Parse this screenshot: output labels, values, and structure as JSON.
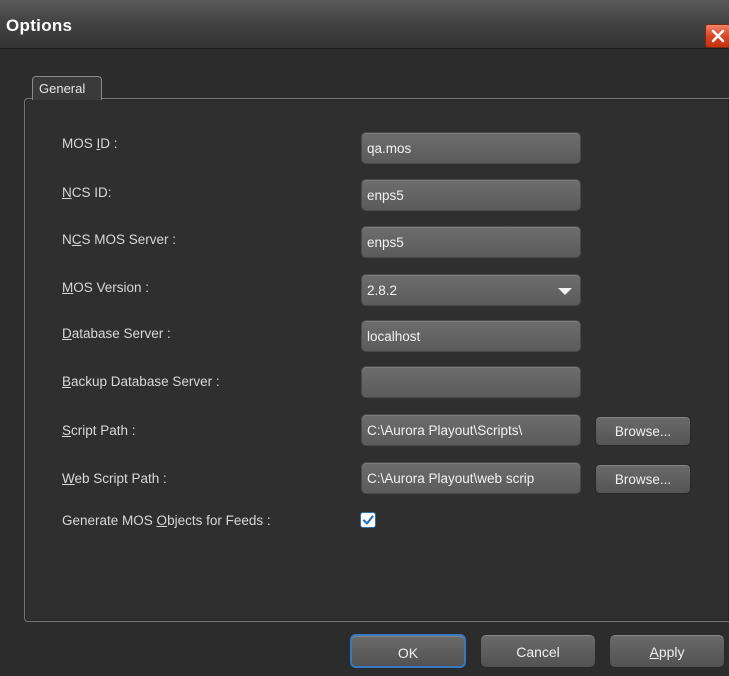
{
  "window": {
    "title": "Options"
  },
  "tabs": [
    {
      "label": "General"
    }
  ],
  "form": {
    "mos_id": {
      "label_pre": "MOS ",
      "label_key": "I",
      "label_post": "D :",
      "value": "qa.mos"
    },
    "ncs_id": {
      "label_pre": "",
      "label_key": "N",
      "label_post": "CS ID:",
      "value": "enps5"
    },
    "ncs_mos_server": {
      "label_pre": "N",
      "label_key": "C",
      "label_post": "S MOS Server :",
      "value": "enps5"
    },
    "mos_version": {
      "label_pre": "",
      "label_key": "M",
      "label_post": "OS Version :",
      "value": "2.8.2"
    },
    "database_server": {
      "label_pre": "",
      "label_key": "D",
      "label_post": "atabase Server :",
      "value": "localhost"
    },
    "backup_database_server": {
      "label_pre": "",
      "label_key": "B",
      "label_post": "ackup Database Server :",
      "value": ""
    },
    "script_path": {
      "label_pre": "",
      "label_key": "S",
      "label_post": "cript Path :",
      "value": "C:\\Aurora Playout\\Scripts\\"
    },
    "web_script_path": {
      "label_pre": "",
      "label_key": "W",
      "label_post": "eb Script Path :",
      "value": "C:\\Aurora Playout\\web scrip"
    },
    "generate_mos_objects": {
      "label_pre": "Generate MOS ",
      "label_key": "O",
      "label_post": "bjects for Feeds :",
      "checked": true
    }
  },
  "buttons": {
    "browse": "Browse...",
    "ok": "OK",
    "cancel": "Cancel",
    "apply_key": "A",
    "apply_rest": "pply"
  },
  "icons": {
    "close": "close-icon",
    "dropdown": "chevron-down-icon",
    "check": "checkmark-icon"
  },
  "colors": {
    "close_button": "#d8421f",
    "default_button_border": "#3b78c4",
    "checkbox_check": "#2d6fb8"
  }
}
